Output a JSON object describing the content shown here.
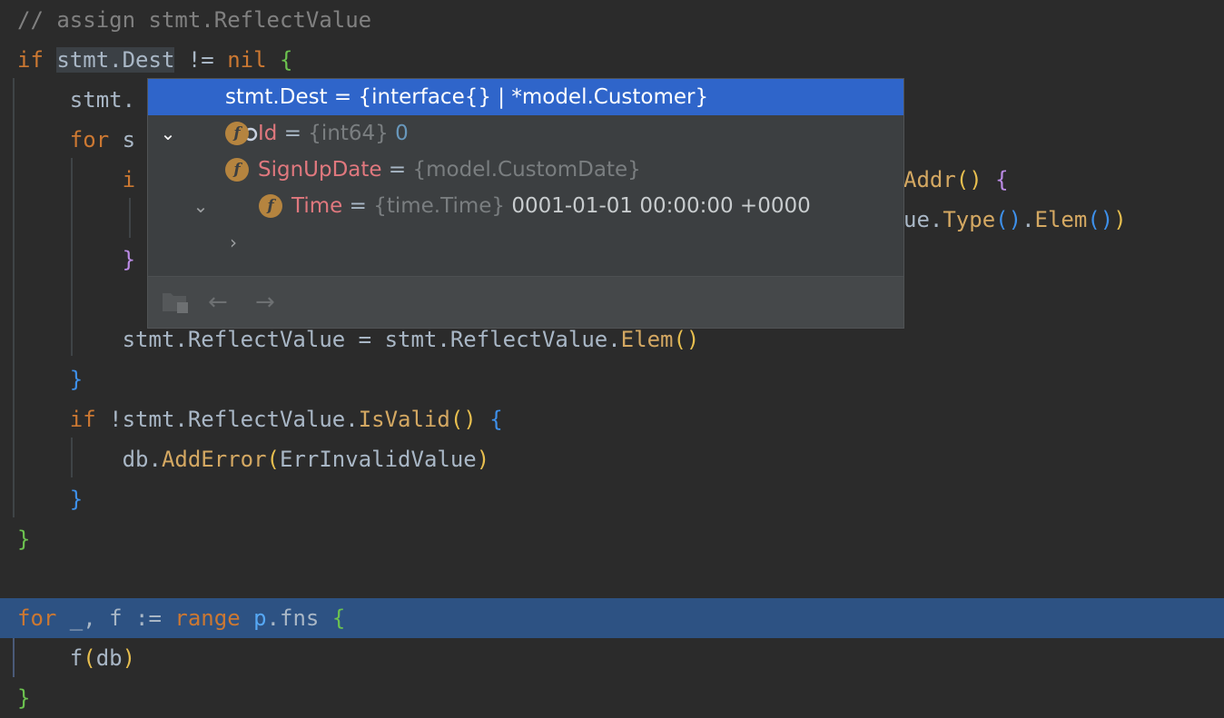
{
  "code": {
    "l1": {
      "comment": "// assign stmt.ReflectValue"
    },
    "l2": {
      "kw_if": "if",
      "var": "stmt.Dest",
      "op": " != ",
      "nil": "nil",
      "brace": "{"
    },
    "l3": {
      "text": "stmt."
    },
    "l4": {
      "kw_for": "for",
      "text": " s"
    },
    "l5": {
      "text": "i",
      "addr": "Addr",
      "paren_open": "(",
      "paren_close": ")",
      "brace": "{"
    },
    "l6": {
      "text": "ue.",
      "type": "Type",
      "p1": "(",
      "p2": ")",
      "dot": ".",
      "elem": "Elem",
      "p3": "(",
      "p4": ")",
      "p5": ")"
    },
    "l7": {
      "brace": "}"
    },
    "l9": {
      "text": "stmt.ReflectValue = stmt.ReflectValue.",
      "elem": "Elem",
      "paren": "()"
    },
    "l10": {
      "brace": "}"
    },
    "l11": {
      "kw_if": "if",
      "text": " !stmt.ReflectValue.",
      "fn": "IsValid",
      "paren": "()",
      "brace": "{"
    },
    "l12": {
      "text": "db.",
      "fn": "AddError",
      "p1": "(",
      "arg": "ErrInvalidValue",
      "p2": ")"
    },
    "l13": {
      "brace": "}"
    },
    "l14": {
      "brace": "}"
    },
    "l16": {
      "kw_for": "for",
      "text1": " _, f := ",
      "kw_range": "range",
      "pkg": "p",
      "text2": ".fns ",
      "brace": "{"
    },
    "l17": {
      "fn": "f",
      "p1": "(",
      "arg": "db",
      "p2": ")"
    },
    "l18": {
      "brace": "}"
    }
  },
  "popup": {
    "root": {
      "name": "stmt.Dest",
      "value": " = {interface{} | *model.Customer}"
    },
    "fields": [
      {
        "name": "Id",
        "eq": " = ",
        "type": "{int64}",
        "value": " 0"
      },
      {
        "name": "SignUpDate",
        "eq": " = ",
        "type": "{model.CustomDate}",
        "value": ""
      },
      {
        "name": "Time",
        "eq": " = ",
        "type": "{time.Time}",
        "value": " 0001-01-01 00:00:00 +0000"
      }
    ],
    "icons": {
      "field_letter": "f"
    }
  },
  "colors": {
    "background": "#2b2b2b",
    "exec_line": "#2d5283",
    "popup_selection": "#2f65ca",
    "keyword": "#cc7832",
    "function": "#d4a862"
  }
}
